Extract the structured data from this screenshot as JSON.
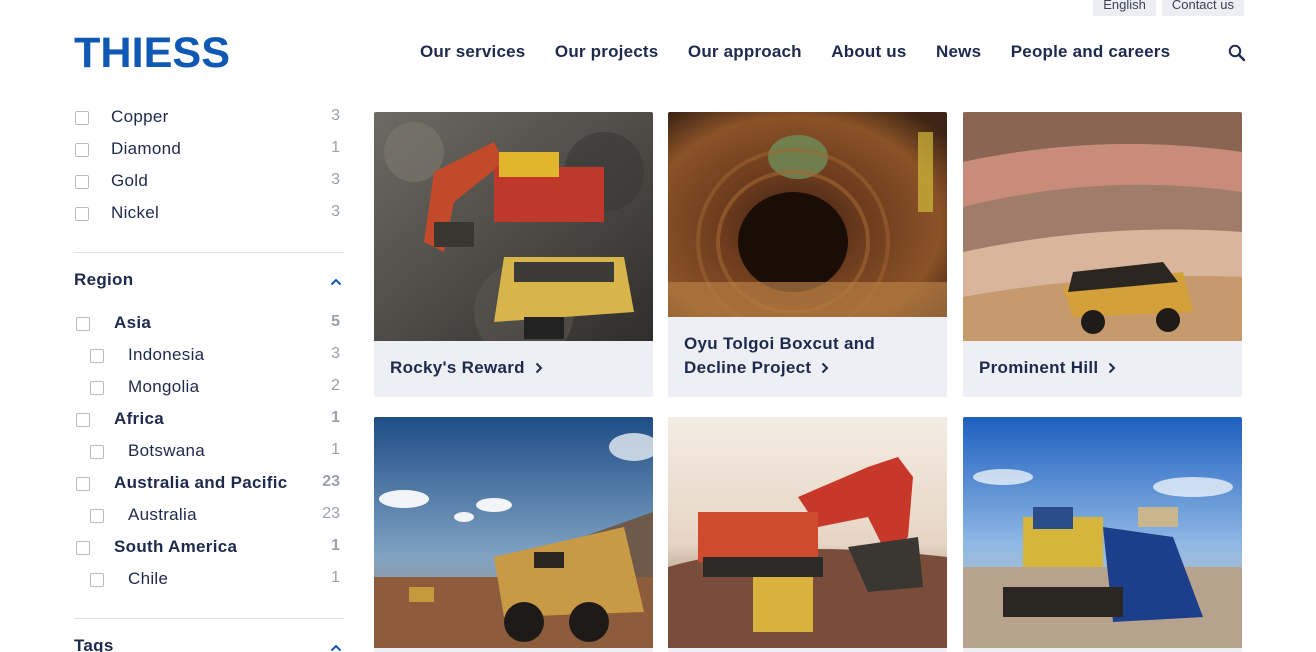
{
  "utility": {
    "language": "English",
    "contact": "Contact us"
  },
  "brand": {
    "name": "THIESS",
    "color": "#0f58b4"
  },
  "nav": {
    "items": [
      "Our services",
      "Our projects",
      "Our approach",
      "About us",
      "News",
      "People and careers"
    ],
    "search_icon": "search-icon"
  },
  "filters": {
    "commodity_items": [
      {
        "label": "Copper",
        "count": "3"
      },
      {
        "label": "Diamond",
        "count": "1"
      },
      {
        "label": "Gold",
        "count": "3"
      },
      {
        "label": "Nickel",
        "count": "3"
      }
    ],
    "region": {
      "title": "Region",
      "items": [
        {
          "label": "Asia",
          "count": "5"
        },
        {
          "label": "Indonesia",
          "count": "3"
        },
        {
          "label": "Mongolia",
          "count": "2"
        },
        {
          "label": "Africa",
          "count": "1"
        },
        {
          "label": "Botswana",
          "count": "1"
        },
        {
          "label": "Australia and Pacific",
          "count": "23"
        },
        {
          "label": "Australia",
          "count": "23"
        },
        {
          "label": "South America",
          "count": "1"
        },
        {
          "label": "Chile",
          "count": "1"
        }
      ]
    },
    "tags": {
      "title": "Tags"
    }
  },
  "projects": [
    {
      "title": "Rocky's Reward"
    },
    {
      "title_line1": "Oyu Tolgoi Boxcut and",
      "title_line2": "Decline Project"
    },
    {
      "title": "Prominent Hill"
    },
    {
      "title": ""
    },
    {
      "title": ""
    },
    {
      "title": ""
    }
  ]
}
